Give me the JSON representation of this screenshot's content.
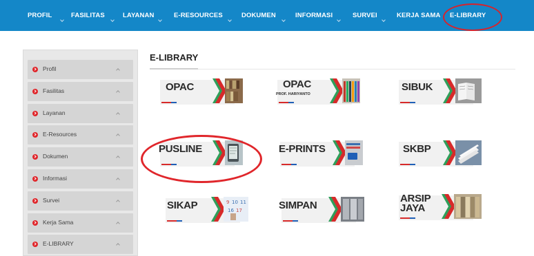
{
  "nav": {
    "items": [
      {
        "label": "PROFIL"
      },
      {
        "label": "FASILITAS"
      },
      {
        "label": "LAYANAN"
      },
      {
        "label": "E-RESOURCES"
      },
      {
        "label": "DOKUMEN"
      },
      {
        "label": "INFORMASI"
      },
      {
        "label": "SURVEI"
      },
      {
        "label": "KERJA SAMA"
      },
      {
        "label": "E-LIBRARY"
      }
    ]
  },
  "sidebar": {
    "items": [
      {
        "label": "Profil"
      },
      {
        "label": "Fasilitas"
      },
      {
        "label": "Layanan"
      },
      {
        "label": "E-Resources"
      },
      {
        "label": "Dokumen"
      },
      {
        "label": "Informasi"
      },
      {
        "label": "Survei"
      },
      {
        "label": "Kerja Sama"
      },
      {
        "label": "E-LIBRARY"
      }
    ]
  },
  "main": {
    "title": "E-LIBRARY",
    "tiles": [
      {
        "label": "OPAC",
        "sub": "",
        "icon": "bookshelf-icon"
      },
      {
        "label": "OPAC",
        "sub": "PROF. HARIYANTO",
        "icon": "books-icon"
      },
      {
        "label": "SIBUK",
        "sub": "",
        "icon": "open-book-icon"
      },
      {
        "label": "PUSLINE",
        "sub": "",
        "icon": "tablet-icon"
      },
      {
        "label": "E-PRINTS",
        "sub": "",
        "icon": "ki-card-icon"
      },
      {
        "label": "SKBP",
        "sub": "",
        "icon": "papers-icon"
      },
      {
        "label": "SIKAP",
        "sub": "",
        "icon": "calendar-icon"
      },
      {
        "label": "SIMPAN",
        "sub": "",
        "icon": "server-rack-icon"
      },
      {
        "label": "ARSIP",
        "sub": "JAYA",
        "icon": "archive-folders-icon"
      }
    ]
  },
  "colors": {
    "nav_bg": "#1487c8",
    "highlight_ring": "#e0262b",
    "accent_red": "#d72a2a",
    "accent_green": "#2f9e5a",
    "accent_blue": "#1f5fb6"
  }
}
